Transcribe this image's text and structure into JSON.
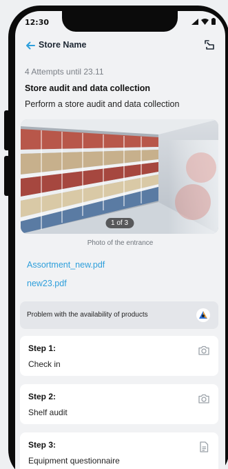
{
  "status_bar": {
    "time": "12:30"
  },
  "header": {
    "title": "Store Name",
    "back_icon": "arrow-left-icon",
    "action_icon": "exit-icon"
  },
  "task": {
    "attempts": "4 Attempts until 23.11",
    "title": "Store audit and data collection",
    "description": "Perform a store audit and data collection"
  },
  "photo": {
    "counter": "1 of 3",
    "caption": "Photo of the entrance"
  },
  "files": [
    {
      "name": "Assortment_new.pdf"
    },
    {
      "name": "new23.pdf"
    }
  ],
  "problem": {
    "text": "Problem with the availability of products",
    "icon": "assistant-logo-icon"
  },
  "steps": [
    {
      "label": "Step 1:",
      "name": "Check in",
      "icon": "camera-icon"
    },
    {
      "label": "Step 2:",
      "name": "Shelf audit",
      "icon": "camera-icon"
    },
    {
      "label": "Step 3:",
      "name": "Equipment questionnaire",
      "icon": "document-icon"
    }
  ],
  "colors": {
    "accent": "#2e9fdb",
    "background": "#f1f2f4",
    "card": "#ffffff"
  }
}
